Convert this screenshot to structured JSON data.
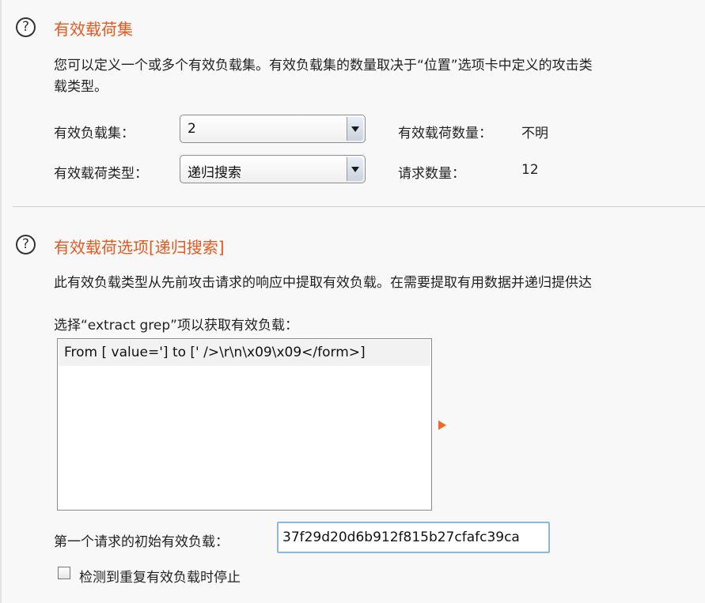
{
  "payload_sets": {
    "help_icon": "?",
    "title": "有效载荷集",
    "description_line1": "您可以定义一个或多个有效负载集。有效负载集的数量取决于“位置”选项卡中定义的攻击类",
    "description_line2": "载类型。",
    "set_label": "有效负载集：",
    "set_value": "2",
    "type_label": "有效载荷类型：",
    "type_value": "递归搜索",
    "count_label": "有效载荷数量：",
    "count_value": "不明",
    "request_label": "请求数量：",
    "request_value": "12"
  },
  "payload_options": {
    "help_icon": "?",
    "title": "有效载荷选项[递归搜索]",
    "description": "此有效负载类型从先前攻击请求的响应中提取有效负载。在需要提取有用数据并递归提供达",
    "grep_label": "选择“extract grep”项以获取有效负载：",
    "grep_items": [
      "From [ value='] to [' />\\r\\n\\x09\\x09</form>]"
    ],
    "initial_label": "第一个请求的初始有效负载：",
    "initial_value": "37f29d20d6b912f815b27cfafc39ca",
    "stop_label": "检测到重复有效负载时停止",
    "stop_checked": false
  },
  "colors": {
    "accent": "#e8581f",
    "background": "#f8f8f8"
  },
  "icons": {
    "help": "question-circle-icon",
    "arrow": "play-arrow-icon",
    "dropdown": "chevron-down-icon"
  }
}
